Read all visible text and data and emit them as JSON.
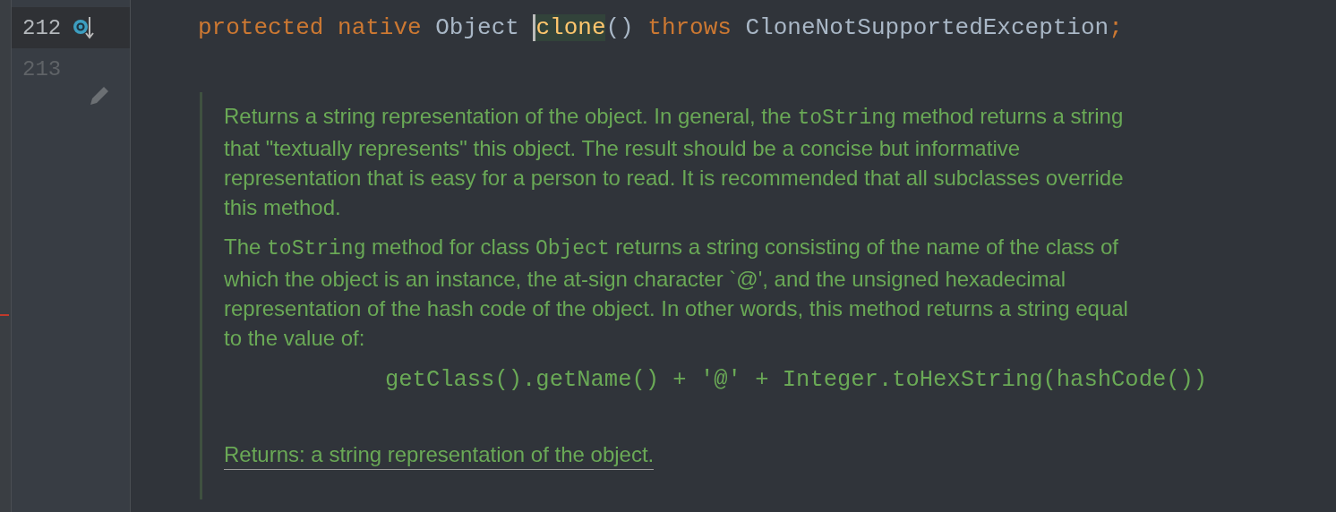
{
  "gutter": {
    "lines": [
      {
        "number": "212",
        "current": true
      },
      {
        "number": "213",
        "current": false
      }
    ]
  },
  "code_line": {
    "tokens": [
      {
        "text": "protected native ",
        "kind": "keyword"
      },
      {
        "text": "Object ",
        "kind": "plain"
      },
      {
        "text": "clone",
        "kind": "method"
      },
      {
        "text": "() ",
        "kind": "plain"
      },
      {
        "text": "throws ",
        "kind": "keyword"
      },
      {
        "text": "CloneNotSupportedException",
        "kind": "plain"
      },
      {
        "text": ";",
        "kind": "keyword"
      }
    ]
  },
  "doc_comment": {
    "paragraphs": [
      {
        "kind": "text",
        "lines": [
          [
            {
              "text": "Returns a string representation of the object. In general, the ",
              "kind": "text"
            },
            {
              "text": "toString",
              "kind": "code"
            },
            {
              "text": " method returns a string",
              "kind": "text"
            }
          ],
          [
            {
              "text": "that \"textually represents\" this object. The result should be a concise but informative",
              "kind": "text"
            }
          ],
          [
            {
              "text": "representation that is easy for a person to read. It is recommended that all subclasses override",
              "kind": "text"
            }
          ],
          [
            {
              "text": "this method.",
              "kind": "text"
            }
          ]
        ]
      },
      {
        "kind": "text",
        "lines": [
          [
            {
              "text": "The ",
              "kind": "text"
            },
            {
              "text": "toString",
              "kind": "code"
            },
            {
              "text": " method for class ",
              "kind": "text"
            },
            {
              "text": "Object",
              "kind": "code"
            },
            {
              "text": " returns a string consisting of the name of the class of",
              "kind": "text"
            }
          ],
          [
            {
              "text": "which the object is an instance, the at-sign character `@', and the unsigned hexadecimal",
              "kind": "text"
            }
          ],
          [
            {
              "text": "representation of the hash code of the object. In other words, this method returns a string equal",
              "kind": "text"
            }
          ],
          [
            {
              "text": "to the value of:",
              "kind": "text"
            }
          ]
        ]
      },
      {
        "kind": "code",
        "lines": [
          [
            {
              "text": "getClass().getName() + '@' + Integer.toHexString(hashCode())",
              "kind": "code"
            }
          ]
        ]
      },
      {
        "kind": "returns",
        "lines": [
          [
            {
              "text": "Returns: a string representation of the object.",
              "kind": "text"
            }
          ]
        ]
      }
    ]
  }
}
